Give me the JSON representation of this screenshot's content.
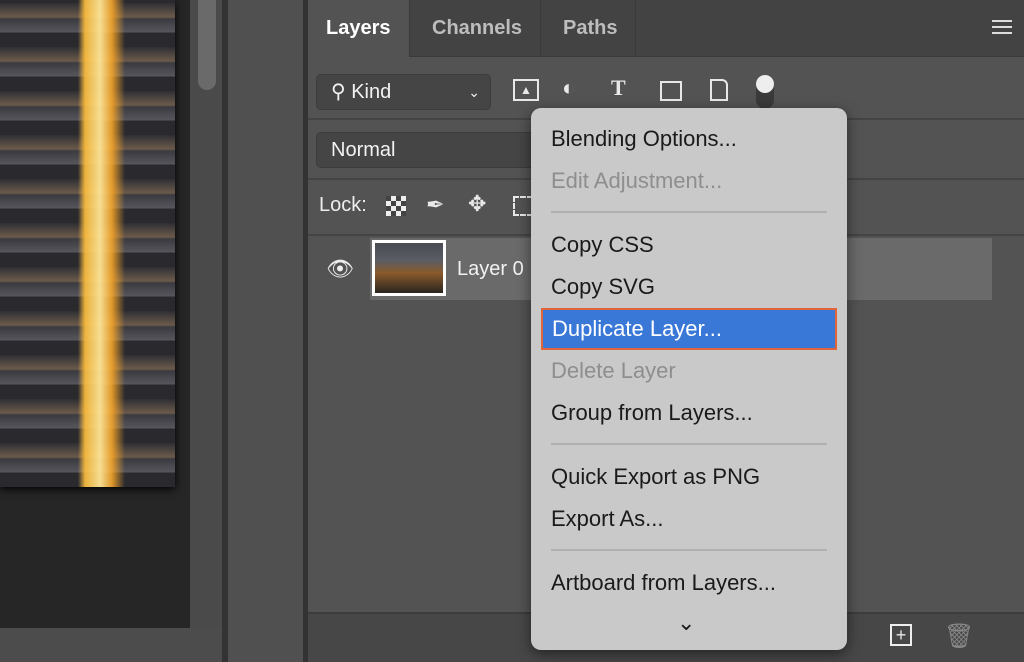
{
  "tabs": [
    {
      "label": "Layers",
      "active": true
    },
    {
      "label": "Channels"
    },
    {
      "label": "Paths"
    }
  ],
  "filter": {
    "kind_label": "Kind",
    "icons": [
      "image-filter-icon",
      "adjustment-filter-icon",
      "type-filter-icon",
      "shape-filter-icon",
      "smart-object-filter-icon",
      "filter-toggle-icon"
    ]
  },
  "blend_mode": "Normal",
  "lock_label": "Lock:",
  "layer": {
    "name": "Layer 0",
    "visible": true
  },
  "context_menu": {
    "items": [
      {
        "label": "Blending Options...",
        "enabled": true
      },
      {
        "label": "Edit Adjustment...",
        "enabled": false
      },
      {
        "label": "Copy CSS",
        "enabled": true
      },
      {
        "label": "Copy SVG",
        "enabled": true
      },
      {
        "label": "Duplicate Layer...",
        "enabled": true,
        "highlighted": true
      },
      {
        "label": "Delete Layer",
        "enabled": false
      },
      {
        "label": "Group from Layers...",
        "enabled": true
      },
      {
        "label": "Quick Export as PNG",
        "enabled": true
      },
      {
        "label": "Export As...",
        "enabled": true
      },
      {
        "label": "Artboard from Layers...",
        "enabled": true
      }
    ]
  },
  "colors": {
    "highlight": "#3a78d8",
    "highlight_border": "#e0643a",
    "panel": "#535353",
    "menu": "#c9c9c9"
  }
}
